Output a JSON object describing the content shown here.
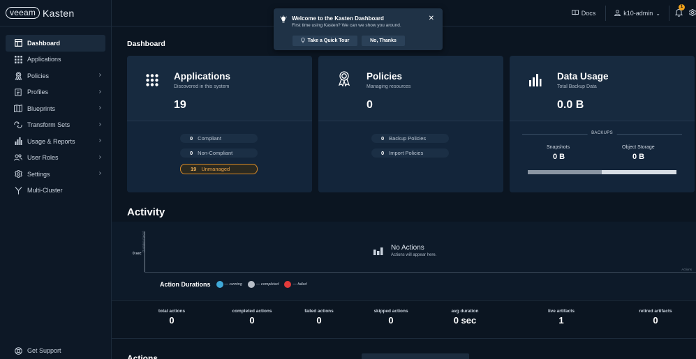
{
  "logo": {
    "brand": "veeam",
    "product": "Kasten"
  },
  "sidebar": {
    "items": [
      {
        "label": "Dashboard",
        "icon": "dashboard-icon",
        "active": true,
        "chevron": false
      },
      {
        "label": "Applications",
        "icon": "grid-icon",
        "active": false,
        "chevron": false
      },
      {
        "label": "Policies",
        "icon": "award-icon",
        "active": false,
        "chevron": true
      },
      {
        "label": "Profiles",
        "icon": "clipboard-icon",
        "active": false,
        "chevron": true
      },
      {
        "label": "Blueprints",
        "icon": "map-icon",
        "active": false,
        "chevron": true
      },
      {
        "label": "Transform Sets",
        "icon": "transform-icon",
        "active": false,
        "chevron": true
      },
      {
        "label": "Usage & Reports",
        "icon": "bar-chart-icon",
        "active": false,
        "chevron": true
      },
      {
        "label": "User Roles",
        "icon": "users-icon",
        "active": false,
        "chevron": true
      },
      {
        "label": "Settings",
        "icon": "gear-icon",
        "active": false,
        "chevron": true
      },
      {
        "label": "Multi-Cluster",
        "icon": "branch-icon",
        "active": false,
        "chevron": false
      }
    ],
    "support": "Get Support"
  },
  "topbar": {
    "docs": "Docs",
    "user": "k10-admin",
    "notifications": "1"
  },
  "welcome": {
    "title": "Welcome to the Kasten Dashboard",
    "subtitle": "First time using Kasten? We can we show you around.",
    "tour_button": "Take a Quick Tour",
    "decline_button": "No, Thanks"
  },
  "page_title": "Dashboard",
  "cards": {
    "applications": {
      "title": "Applications",
      "subtitle": "Discovered in this system",
      "value": "19",
      "compliant_count": "0",
      "compliant_label": "Compliant",
      "noncompliant_count": "0",
      "noncompliant_label": "Non-Compliant",
      "unmanaged_count": "19",
      "unmanaged_label": "Unmanaged"
    },
    "policies": {
      "title": "Policies",
      "subtitle": "Managing resources",
      "value": "0",
      "backup_count": "0",
      "backup_label": "Backup Policies",
      "import_count": "0",
      "import_label": "Import Policies"
    },
    "data_usage": {
      "title": "Data Usage",
      "subtitle": "Total Backup Data",
      "value": "0.0 B",
      "backups_label": "BACKUPS",
      "snapshots_label": "Snapshots",
      "snapshots_value": "0 B",
      "object_storage_label": "Object Storage",
      "object_storage_value": "0 B"
    }
  },
  "activity": {
    "title": "Activity",
    "ylabel": "Duration (secs)",
    "ytick": "0 sec",
    "xlabel": "Actions",
    "empty_title": "No Actions",
    "empty_sub": "Actions will appear here.",
    "legend_title": "Action Durations",
    "legend": [
      {
        "label": "— running",
        "color": "#3fa9d8"
      },
      {
        "label": "— completed",
        "color": "#b7bec7"
      },
      {
        "label": "— failed",
        "color": "#e23b3b"
      }
    ]
  },
  "stats": [
    {
      "label": "total actions",
      "value": "0"
    },
    {
      "label": "completed actions",
      "value": "0"
    },
    {
      "label": "failed actions",
      "value": "0"
    },
    {
      "label": "skipped actions",
      "value": "0"
    },
    {
      "label": "avg duration",
      "value": "0 sec"
    },
    {
      "label": "live artifacts",
      "value": "1"
    },
    {
      "label": "retired artifacts",
      "value": "0"
    }
  ],
  "bottom_section_title": "Actions"
}
